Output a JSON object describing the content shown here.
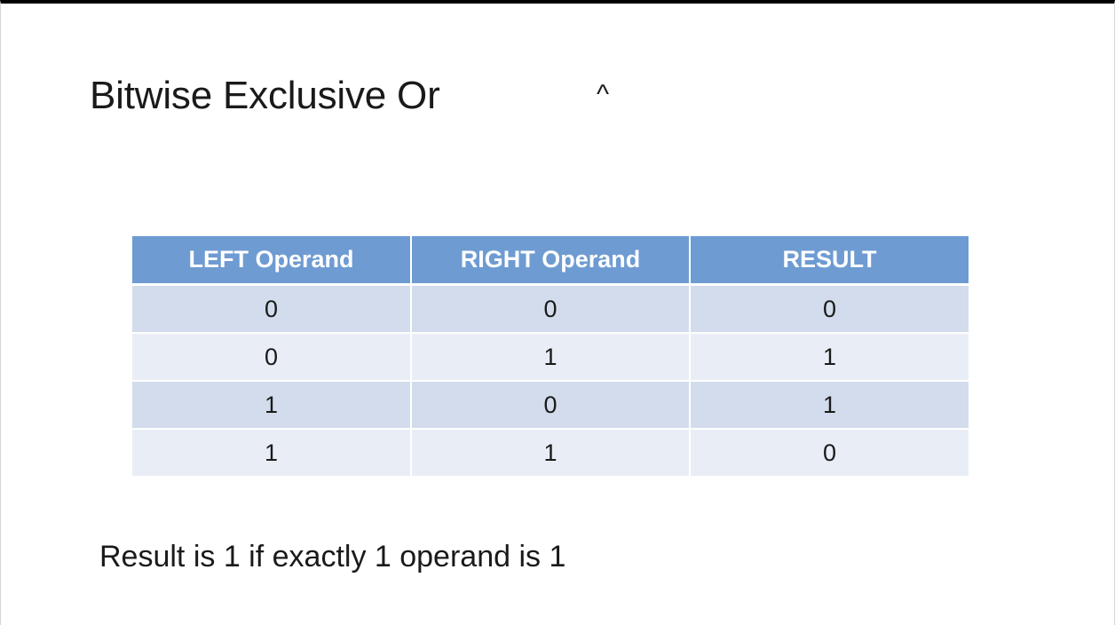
{
  "slide": {
    "title": "Bitwise Exclusive Or",
    "operator_symbol": "^",
    "note": "Result is 1 if exactly 1 operand is 1"
  },
  "table": {
    "headers": [
      "LEFT Operand",
      "RIGHT Operand",
      "RESULT"
    ],
    "rows": [
      [
        "0",
        "0",
        "0"
      ],
      [
        "0",
        "1",
        "1"
      ],
      [
        "1",
        "0",
        "1"
      ],
      [
        "1",
        "1",
        "0"
      ]
    ]
  },
  "colors": {
    "header_bg": "#6e9bd2",
    "row_dark": "#d2dcec",
    "row_light": "#e9eef6",
    "text": "#1a1a1a"
  }
}
